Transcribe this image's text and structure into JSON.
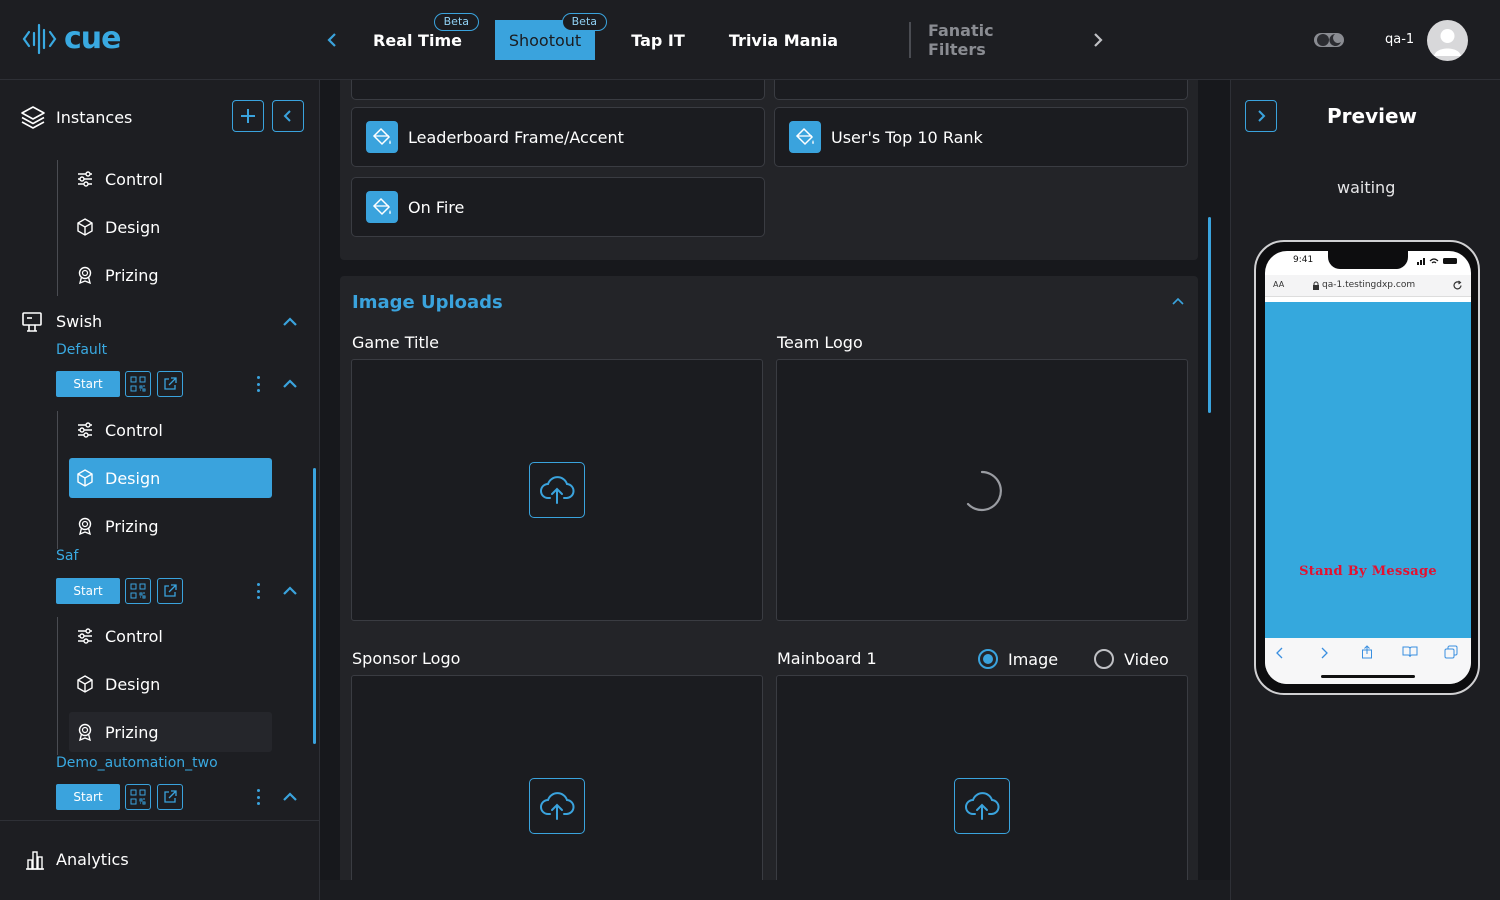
{
  "app": {
    "name": "cue"
  },
  "header": {
    "tabs": [
      {
        "label": "Real Time",
        "badge": "Beta"
      },
      {
        "label": "Shootout",
        "badge": "Beta",
        "active": true
      },
      {
        "label": "Tap IT"
      },
      {
        "label": "Trivia Mania"
      },
      {
        "label": "Fanatic Filters"
      }
    ],
    "user": "qa-1"
  },
  "sidebar": {
    "instances_label": "Instances",
    "group1_items": [
      "Control",
      "Design",
      "Prizing"
    ],
    "game": "Swish",
    "instances": [
      {
        "name": "Default",
        "start": "Start",
        "items": [
          "Control",
          "Design",
          "Prizing"
        ]
      },
      {
        "name": "Saf",
        "start": "Start",
        "items": [
          "Control",
          "Design",
          "Prizing"
        ]
      },
      {
        "name": "Demo_automation_two",
        "start": "Start"
      }
    ],
    "analytics": "Analytics"
  },
  "main": {
    "cards": [
      "Leaderboard Frame/Accent",
      "User's Top 10 Rank",
      "On Fire"
    ],
    "image_uploads": {
      "title": "Image Uploads",
      "fields": [
        "Game Title",
        "Team Logo",
        "Sponsor Logo",
        "Mainboard 1"
      ],
      "media_options": [
        "Image",
        "Video"
      ],
      "selected": "Image"
    }
  },
  "preview": {
    "title": "Preview",
    "status": "waiting",
    "phone": {
      "time": "9:41",
      "text_size": "AA",
      "url": "qa-1.testingdxp.com",
      "message": "Stand By Message"
    }
  },
  "colors": {
    "accent": "#3aa3dd",
    "bg": "#1b1c20",
    "message": "#e5102f"
  }
}
